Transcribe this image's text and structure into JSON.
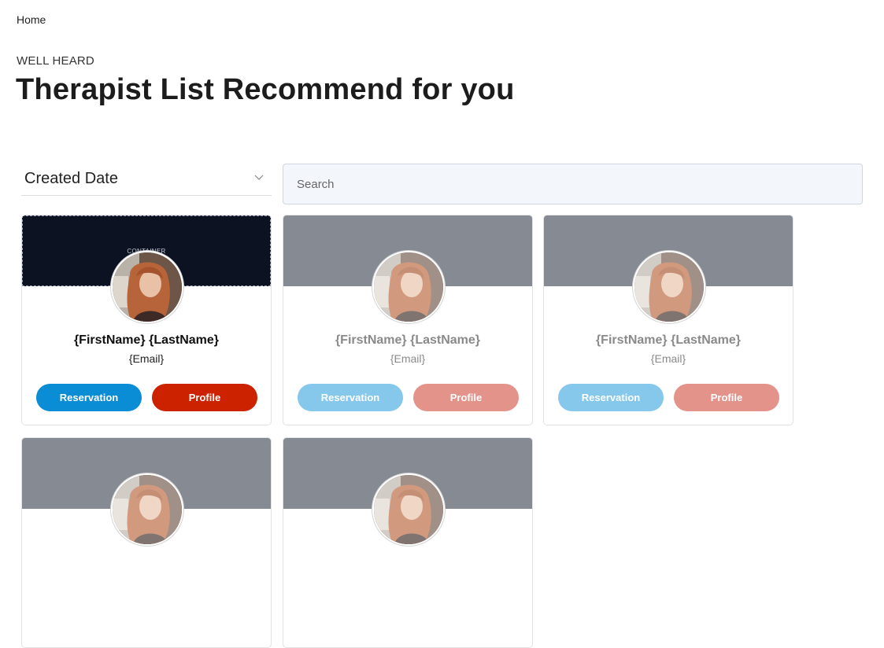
{
  "breadcrumb": {
    "home": "Home"
  },
  "header": {
    "eyebrow": "WELL HEARD",
    "title": "Therapist List Recommend for you"
  },
  "filters": {
    "sort_value": "Created Date",
    "search_placeholder": "Search"
  },
  "card_labels": {
    "name": "{FirstName} {LastName}",
    "email": "{Email}",
    "reservation": "Reservation",
    "profile": "Profile",
    "container_tag": "CONTAINER"
  },
  "colors": {
    "primary_button": "#0b8dd6",
    "profile_button": "#cc2200",
    "banner": "#868a93",
    "selected_banner": "#0c1222"
  },
  "icons": {
    "sort": "chevron-down-icon"
  }
}
